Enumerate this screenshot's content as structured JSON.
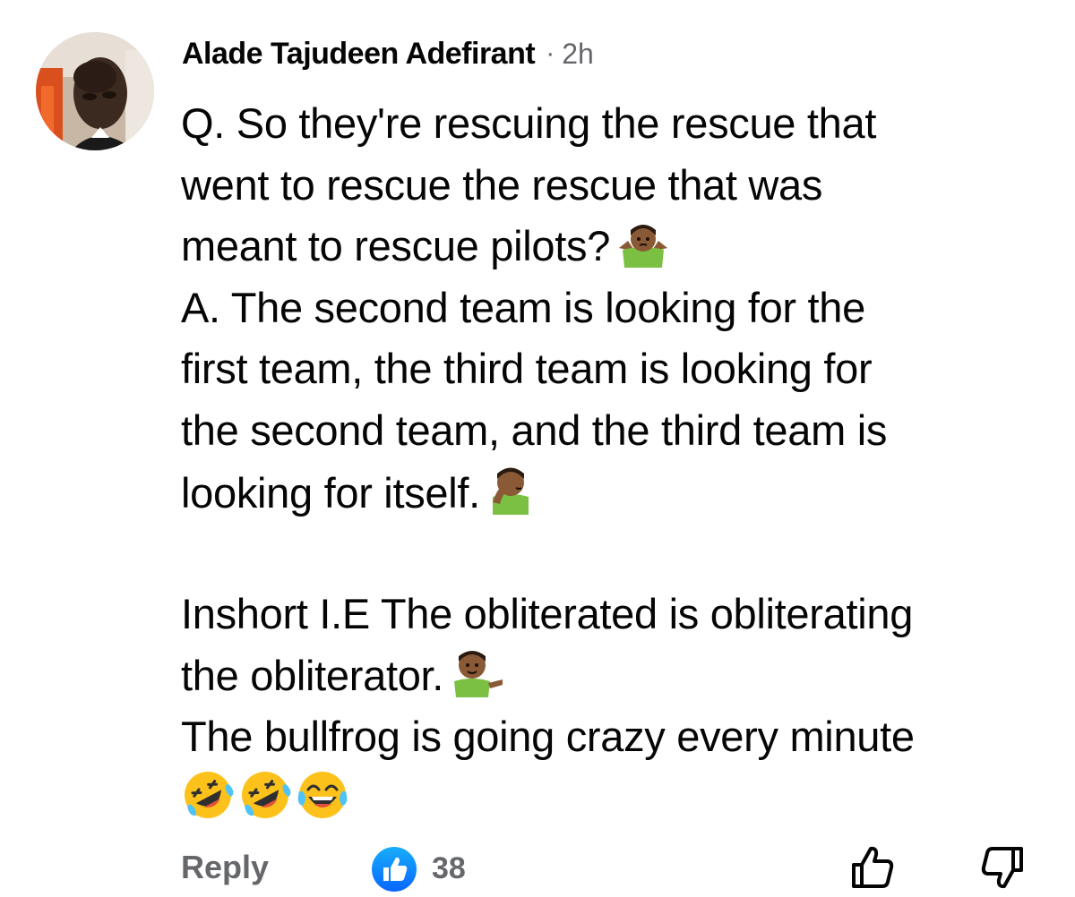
{
  "comment": {
    "author": "Alade Tajudeen Adefirant",
    "separator": "·",
    "time": "2h",
    "lines": [
      "Q. So they're rescuing the rescue that",
      "went to rescue the rescue that was",
      "meant to rescue pilots?",
      "A. The second team is looking for the",
      "first team, the third team is looking for",
      "the second team, and the third team is",
      "looking for itself.",
      "",
      "Inshort I.E The obliterated is obliterating",
      "the obliterator.",
      "The bullfrog is going crazy every minute"
    ],
    "emojis": {
      "line3": "person-shrugging-emoji",
      "line7": "person-facepalming-emoji",
      "line10": "person-tipping-hand-emoji",
      "line12": [
        "rolling-on-floor-laughing-emoji",
        "rolling-on-floor-laughing-emoji",
        "face-with-tears-of-joy-emoji"
      ]
    }
  },
  "actions": {
    "reply_label": "Reply",
    "like_count": "38",
    "like_icon": "like-badge-icon",
    "upvote_icon": "thumbs-up-icon",
    "downvote_icon": "thumbs-down-icon"
  },
  "colors": {
    "text": "#050505",
    "secondary": "#65676b",
    "like_blue": "#1877f2",
    "shirt_green": "#7bc043"
  }
}
